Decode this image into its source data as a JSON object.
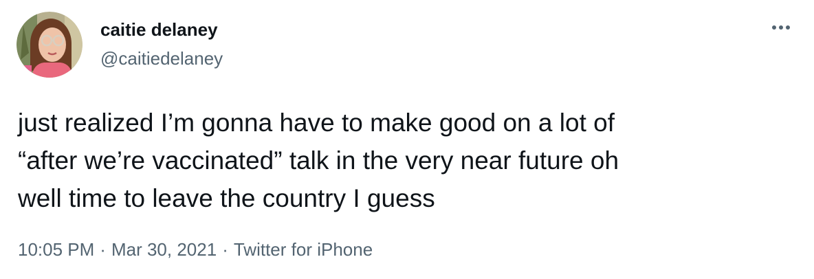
{
  "author": {
    "display_name": "caitie delaney",
    "handle": "@caitiedelaney",
    "avatar_icon": "user-avatar-photo"
  },
  "menu": {
    "icon": "more-horizontal-icon"
  },
  "tweet": {
    "text": "just realized I’m gonna have to make good on a lot of\n“after we’re vaccinated” talk in the very near future oh\nwell time to leave the country I guess"
  },
  "meta": {
    "time": "10:05 PM",
    "separator": "·",
    "date": "Mar 30, 2021",
    "source": "Twitter for iPhone"
  },
  "colors": {
    "primary_text": "#0f1419",
    "secondary_text": "#536471",
    "background": "#ffffff"
  }
}
